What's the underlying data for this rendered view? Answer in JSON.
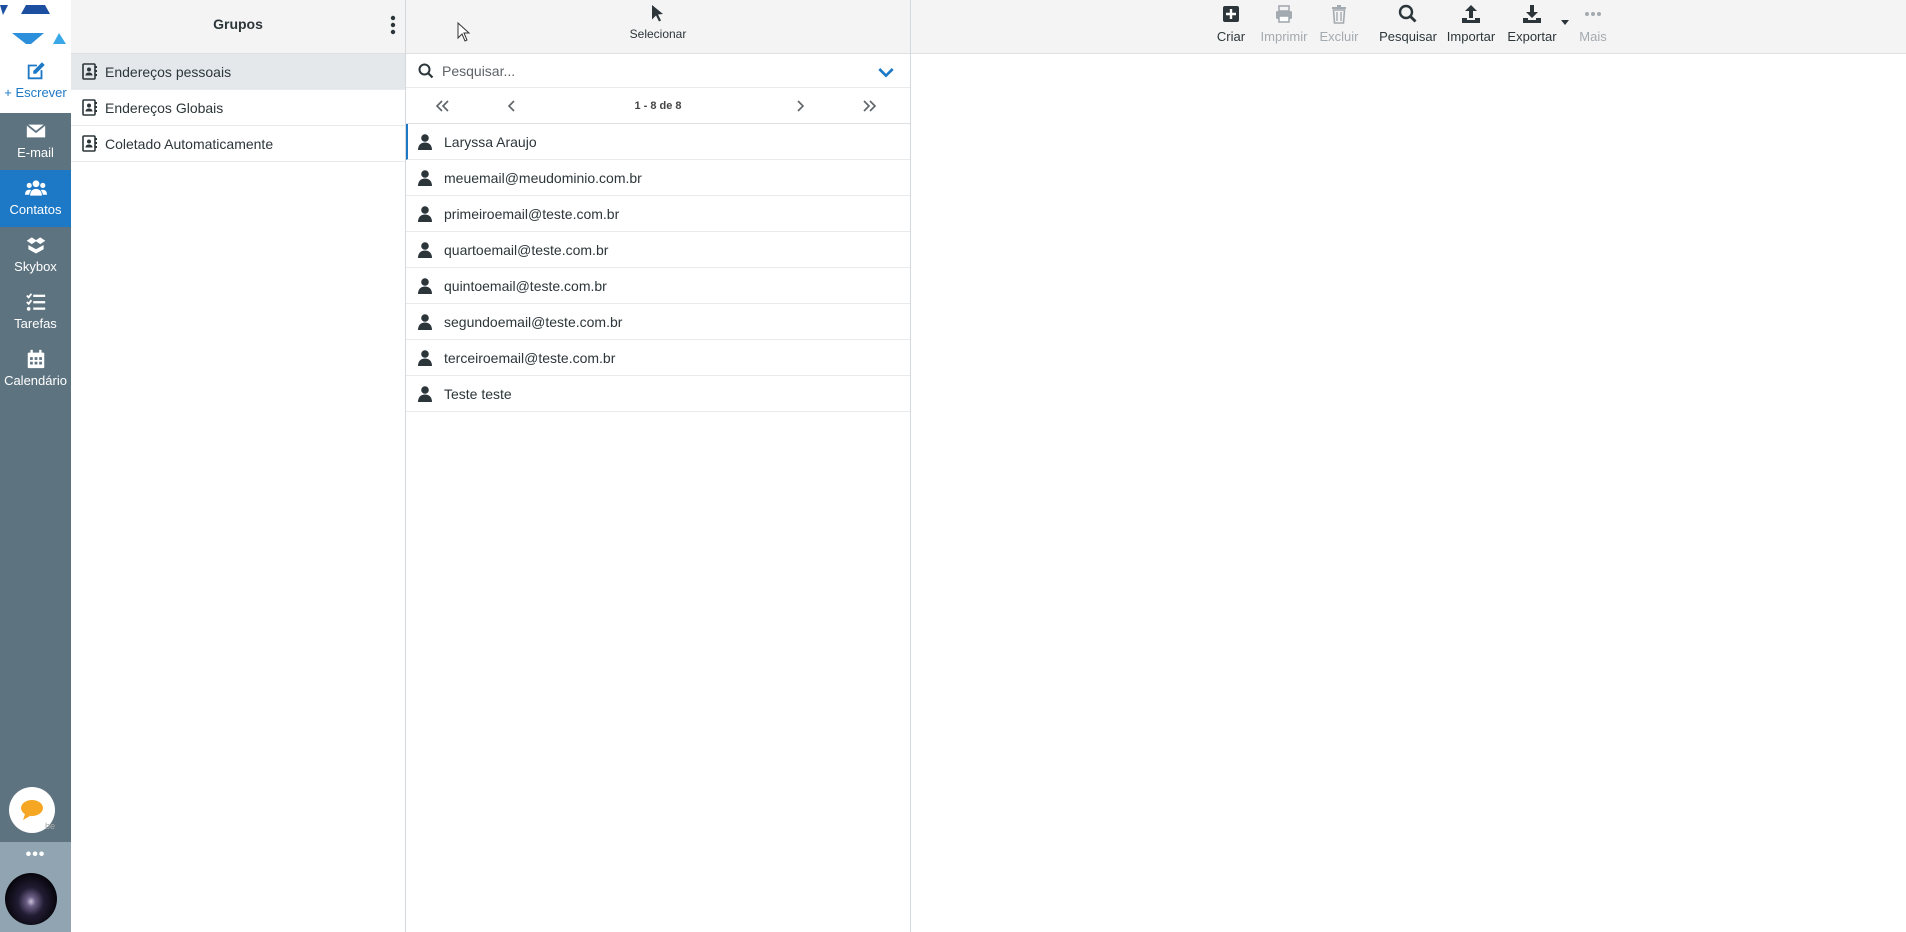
{
  "nav": {
    "compose": "+ Escrever",
    "items": [
      {
        "label": "E-mail",
        "icon": "envelope-icon"
      },
      {
        "label": "Contatos",
        "icon": "users-icon",
        "active": true
      },
      {
        "label": "Skybox",
        "icon": "boxes-icon"
      },
      {
        "label": "Tarefas",
        "icon": "tasks-icon"
      },
      {
        "label": "Calendário",
        "icon": "calendar-icon"
      }
    ],
    "chat_badge": "be",
    "more": "•••"
  },
  "groups": {
    "title": "Grupos",
    "items": [
      {
        "label": "Endereços pessoais",
        "selected": true
      },
      {
        "label": "Endereços Globais"
      },
      {
        "label": "Coletado Automaticamente"
      }
    ]
  },
  "list": {
    "select_label": "Selecionar",
    "search_placeholder": "Pesquisar...",
    "pager_count": "1 - 8 de 8",
    "contacts": [
      "Laryssa Araujo",
      "meuemail@meudominio.com.br",
      "primeiroemail@teste.com.br",
      "quartoemail@teste.com.br",
      "quintoemail@teste.com.br",
      "segundoemail@teste.com.br",
      "terceiroemail@teste.com.br",
      "Teste teste"
    ]
  },
  "toolbar": {
    "create": "Criar",
    "print": "Imprimir",
    "delete": "Excluir",
    "search": "Pesquisar",
    "import": "Importar",
    "export": "Exportar",
    "more": "Mais"
  },
  "colors": {
    "accent": "#1d79c6",
    "nav_bg": "#5e7380",
    "toolbar_bg": "#f4f4f4"
  }
}
